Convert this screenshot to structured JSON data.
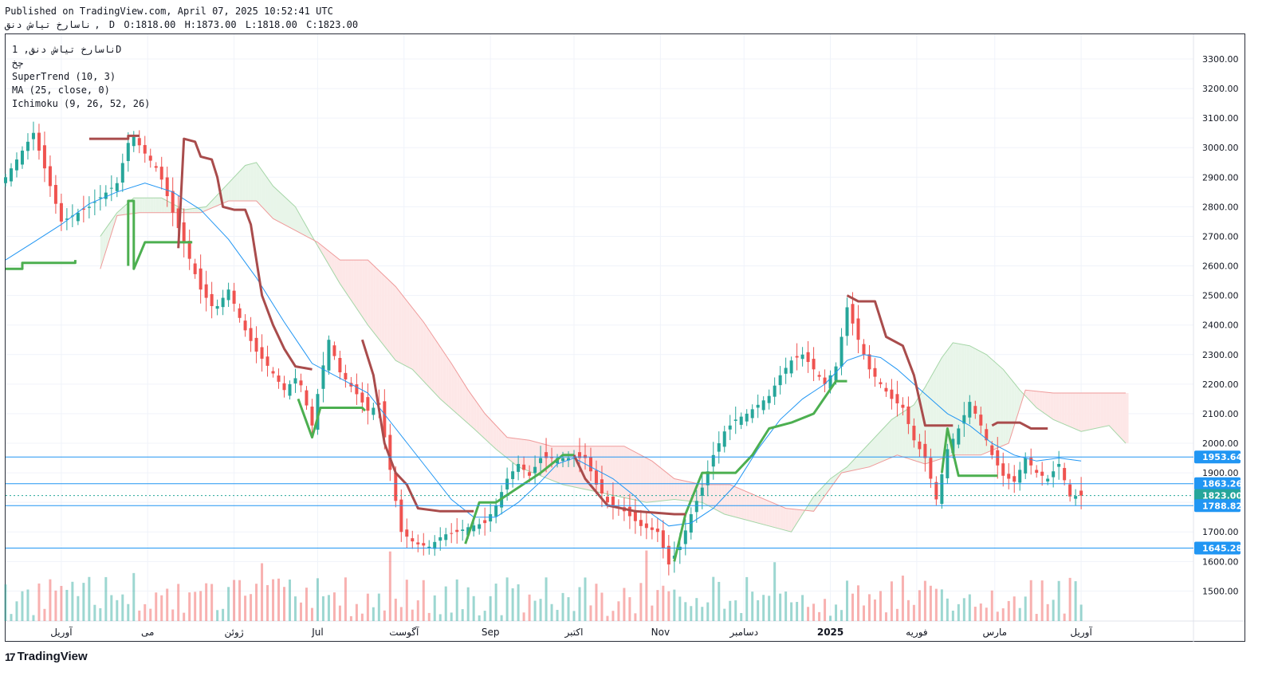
{
  "header": {
    "published": "Published on TradingView.com, April 07, 2025 10:52:41 UTC",
    "symbol": "ناسارخ  تیاش دنق",
    "interval": "D",
    "ohlc": {
      "o": "O:1818.00",
      "h": "H:1873.00",
      "l": "L:1818.00",
      "c": "C:1823.00"
    }
  },
  "legend": {
    "symbol_interval": "ناسارخ تیاش دنق, 1D",
    "alias": "چخ",
    "indicators": [
      "SuperTrend (10, 3)",
      "MA (25, close, 0)",
      "Ichimoku (9, 26, 52, 26)"
    ]
  },
  "footer": {
    "brand": "TradingView",
    "mark": "17"
  },
  "colors": {
    "up": "#26a69a",
    "down": "#ef5350",
    "supertrend_up": "#4caf50",
    "supertrend_down": "#a94c4c",
    "ma": "#2196f3",
    "cloud_up": "#e8f5e9",
    "cloud_down": "#fde7e7",
    "hline": "#2196f3",
    "label_blue": "#2196f3",
    "label_teal": "#26a69a"
  },
  "chart_data": {
    "type": "candlestick",
    "y_axis": {
      "min": 1400,
      "max": 3350,
      "ticks": [
        1500,
        1600,
        1700,
        1800,
        1900,
        2000,
        2100,
        2200,
        2300,
        2400,
        2500,
        2600,
        2700,
        2800,
        2900,
        3000,
        3100,
        3200,
        3300
      ],
      "tick_labels": [
        "1500.00",
        "1600.00",
        "1700.00",
        "1800.00",
        "1900.00",
        "2000.00",
        "2100.00",
        "2200.00",
        "2300.00",
        "2400.00",
        "2500.00",
        "2600.00",
        "2700.00",
        "2800.00",
        "2900.00",
        "3000.00",
        "3100.00",
        "3200.00",
        "3300.00"
      ]
    },
    "x_labels": [
      {
        "label": "آوریل",
        "day": 20
      },
      {
        "label": "می",
        "day": 51
      },
      {
        "label": "ژوئن",
        "day": 82
      },
      {
        "label": "Jul",
        "day": 112
      },
      {
        "label": "آگوست",
        "day": 143
      },
      {
        "label": "Sep",
        "day": 174
      },
      {
        "label": "اکتبر",
        "day": 204
      },
      {
        "label": "Nov",
        "day": 235
      },
      {
        "label": "دسامبر",
        "day": 265
      },
      {
        "label": "2025",
        "day": 296,
        "bold": true
      },
      {
        "label": "فوریه",
        "day": 327
      },
      {
        "label": "مارس",
        "day": 355
      },
      {
        "label": "آوریل",
        "day": 386
      }
    ],
    "x_range_days": [
      0,
      410
    ],
    "price_close_points": [
      [
        0,
        2900
      ],
      [
        10,
        3050
      ],
      [
        20,
        2750
      ],
      [
        30,
        2800
      ],
      [
        40,
        2880
      ],
      [
        45,
        3050
      ],
      [
        50,
        2980
      ],
      [
        55,
        2920
      ],
      [
        60,
        2780
      ],
      [
        65,
        2650
      ],
      [
        70,
        2520
      ],
      [
        75,
        2450
      ],
      [
        80,
        2520
      ],
      [
        85,
        2400
      ],
      [
        90,
        2310
      ],
      [
        95,
        2250
      ],
      [
        100,
        2180
      ],
      [
        105,
        2230
      ],
      [
        110,
        2060
      ],
      [
        113,
        2220
      ],
      [
        116,
        2350
      ],
      [
        120,
        2240
      ],
      [
        125,
        2180
      ],
      [
        130,
        2110
      ],
      [
        134,
        2130
      ],
      [
        138,
        1910
      ],
      [
        142,
        1700
      ],
      [
        147,
        1660
      ],
      [
        152,
        1650
      ],
      [
        157,
        1690
      ],
      [
        162,
        1700
      ],
      [
        167,
        1720
      ],
      [
        172,
        1730
      ],
      [
        176,
        1790
      ],
      [
        180,
        1880
      ],
      [
        184,
        1930
      ],
      [
        188,
        1890
      ],
      [
        192,
        1950
      ],
      [
        196,
        1950
      ],
      [
        200,
        1950
      ],
      [
        204,
        1950
      ],
      [
        208,
        1950
      ],
      [
        212,
        1860
      ],
      [
        216,
        1800
      ],
      [
        222,
        1770
      ],
      [
        228,
        1720
      ],
      [
        234,
        1700
      ],
      [
        238,
        1590
      ],
      [
        242,
        1650
      ],
      [
        246,
        1760
      ],
      [
        250,
        1850
      ],
      [
        254,
        1960
      ],
      [
        258,
        2040
      ],
      [
        262,
        2080
      ],
      [
        266,
        2100
      ],
      [
        270,
        2130
      ],
      [
        274,
        2160
      ],
      [
        278,
        2230
      ],
      [
        282,
        2280
      ],
      [
        286,
        2300
      ],
      [
        290,
        2250
      ],
      [
        294,
        2200
      ],
      [
        298,
        2260
      ],
      [
        302,
        2460
      ],
      [
        306,
        2350
      ],
      [
        310,
        2250
      ],
      [
        314,
        2200
      ],
      [
        318,
        2150
      ],
      [
        322,
        2120
      ],
      [
        326,
        2010
      ],
      [
        330,
        1950
      ],
      [
        334,
        1810
      ],
      [
        338,
        1980
      ],
      [
        342,
        2050
      ],
      [
        346,
        2140
      ],
      [
        350,
        2060
      ],
      [
        354,
        1960
      ],
      [
        358,
        1890
      ],
      [
        362,
        1870
      ],
      [
        366,
        1950
      ],
      [
        370,
        1900
      ],
      [
        374,
        1880
      ],
      [
        378,
        1930
      ],
      [
        382,
        1820
      ],
      [
        386,
        1823
      ]
    ],
    "ma_points": [
      [
        0,
        2620
      ],
      [
        10,
        2680
      ],
      [
        20,
        2740
      ],
      [
        30,
        2810
      ],
      [
        40,
        2850
      ],
      [
        50,
        2880
      ],
      [
        60,
        2850
      ],
      [
        70,
        2790
      ],
      [
        80,
        2690
      ],
      [
        90,
        2560
      ],
      [
        100,
        2410
      ],
      [
        110,
        2270
      ],
      [
        120,
        2220
      ],
      [
        130,
        2170
      ],
      [
        140,
        2050
      ],
      [
        150,
        1930
      ],
      [
        160,
        1810
      ],
      [
        168,
        1750
      ],
      [
        176,
        1750
      ],
      [
        184,
        1800
      ],
      [
        192,
        1870
      ],
      [
        198,
        1930
      ],
      [
        204,
        1950
      ],
      [
        210,
        1920
      ],
      [
        218,
        1880
      ],
      [
        226,
        1820
      ],
      [
        232,
        1760
      ],
      [
        238,
        1720
      ],
      [
        246,
        1730
      ],
      [
        254,
        1780
      ],
      [
        262,
        1860
      ],
      [
        270,
        1980
      ],
      [
        278,
        2080
      ],
      [
        286,
        2150
      ],
      [
        294,
        2200
      ],
      [
        302,
        2280
      ],
      [
        308,
        2300
      ],
      [
        314,
        2290
      ],
      [
        320,
        2250
      ],
      [
        326,
        2200
      ],
      [
        332,
        2150
      ],
      [
        338,
        2100
      ],
      [
        346,
        2060
      ],
      [
        354,
        2000
      ],
      [
        362,
        1960
      ],
      [
        370,
        1940
      ],
      [
        378,
        1950
      ],
      [
        386,
        1940
      ]
    ],
    "supertrend_up": [
      [
        [
          0,
          2590
        ],
        [
          6,
          2590
        ],
        [
          6,
          2610
        ],
        [
          25,
          2610
        ],
        [
          25,
          2620
        ]
      ],
      [
        [
          44,
          2600
        ],
        [
          44,
          2820
        ],
        [
          46,
          2820
        ],
        [
          46,
          2590
        ],
        [
          50,
          2680
        ],
        [
          67,
          2680
        ]
      ],
      [
        [
          105,
          2150
        ],
        [
          110,
          2020
        ],
        [
          113,
          2120
        ],
        [
          128,
          2120
        ],
        [
          129,
          2110
        ]
      ],
      [
        [
          165,
          1660
        ],
        [
          170,
          1800
        ],
        [
          176,
          1800
        ],
        [
          184,
          1850
        ],
        [
          192,
          1900
        ],
        [
          200,
          1960
        ],
        [
          204,
          1960
        ]
      ],
      [
        [
          240,
          1600
        ],
        [
          244,
          1760
        ],
        [
          250,
          1900
        ],
        [
          262,
          1900
        ],
        [
          268,
          1960
        ],
        [
          274,
          2050
        ],
        [
          282,
          2070
        ],
        [
          290,
          2100
        ],
        [
          298,
          2210
        ],
        [
          302,
          2210
        ]
      ],
      [
        [
          336,
          1900
        ],
        [
          338,
          2050
        ],
        [
          342,
          1890
        ],
        [
          352,
          1890
        ],
        [
          356,
          1890
        ]
      ]
    ],
    "supertrend_down": [
      [
        [
          30,
          3030
        ],
        [
          44,
          3030
        ],
        [
          44,
          3040
        ],
        [
          48,
          3040
        ]
      ],
      [
        [
          62,
          2660
        ],
        [
          64,
          3030
        ],
        [
          68,
          3020
        ],
        [
          70,
          2970
        ],
        [
          74,
          2960
        ],
        [
          76,
          2900
        ],
        [
          78,
          2800
        ],
        [
          82,
          2790
        ],
        [
          86,
          2790
        ],
        [
          88,
          2740
        ],
        [
          92,
          2500
        ],
        [
          96,
          2400
        ],
        [
          100,
          2320
        ],
        [
          104,
          2260
        ],
        [
          110,
          2250
        ]
      ],
      [
        [
          128,
          2350
        ],
        [
          132,
          2230
        ],
        [
          136,
          2000
        ],
        [
          140,
          1900
        ],
        [
          144,
          1860
        ],
        [
          148,
          1780
        ],
        [
          156,
          1770
        ],
        [
          168,
          1770
        ]
      ],
      [
        [
          204,
          1960
        ],
        [
          208,
          1880
        ],
        [
          216,
          1790
        ],
        [
          226,
          1770
        ],
        [
          240,
          1760
        ],
        [
          244,
          1760
        ]
      ],
      [
        [
          302,
          2500
        ],
        [
          306,
          2480
        ],
        [
          312,
          2480
        ],
        [
          316,
          2360
        ],
        [
          322,
          2330
        ],
        [
          326,
          2230
        ],
        [
          330,
          2060
        ],
        [
          336,
          2060
        ],
        [
          340,
          2060
        ]
      ],
      [
        [
          354,
          2060
        ],
        [
          356,
          2070
        ],
        [
          364,
          2070
        ],
        [
          368,
          2050
        ],
        [
          374,
          2050
        ]
      ]
    ],
    "cloud_boundaries": {
      "span_a": [
        [
          34,
          2700
        ],
        [
          40,
          2780
        ],
        [
          46,
          2830
        ],
        [
          56,
          2830
        ],
        [
          64,
          2790
        ],
        [
          72,
          2800
        ],
        [
          80,
          2880
        ],
        [
          86,
          2940
        ],
        [
          90,
          2950
        ],
        [
          96,
          2870
        ],
        [
          104,
          2800
        ],
        [
          110,
          2700
        ],
        [
          120,
          2540
        ],
        [
          130,
          2400
        ],
        [
          140,
          2280
        ],
        [
          146,
          2250
        ],
        [
          156,
          2150
        ],
        [
          162,
          2100
        ],
        [
          168,
          2050
        ],
        [
          176,
          1980
        ],
        [
          184,
          1920
        ],
        [
          192,
          1890
        ],
        [
          200,
          1860
        ],
        [
          210,
          1840
        ],
        [
          220,
          1820
        ],
        [
          230,
          1800
        ],
        [
          240,
          1810
        ],
        [
          250,
          1800
        ],
        [
          258,
          1760
        ],
        [
          266,
          1740
        ],
        [
          274,
          1720
        ],
        [
          282,
          1700
        ],
        [
          290,
          1820
        ],
        [
          296,
          1880
        ],
        [
          302,
          1920
        ],
        [
          310,
          2000
        ],
        [
          318,
          2080
        ],
        [
          326,
          2130
        ],
        [
          330,
          2190
        ],
        [
          336,
          2290
        ],
        [
          340,
          2340
        ],
        [
          346,
          2330
        ],
        [
          352,
          2300
        ],
        [
          358,
          2250
        ],
        [
          364,
          2180
        ],
        [
          370,
          2120
        ],
        [
          376,
          2080
        ],
        [
          386,
          2040
        ],
        [
          396,
          2060
        ],
        [
          402,
          2000
        ]
      ],
      "span_b": [
        [
          34,
          2590
        ],
        [
          40,
          2770
        ],
        [
          48,
          2780
        ],
        [
          60,
          2780
        ],
        [
          70,
          2780
        ],
        [
          80,
          2820
        ],
        [
          90,
          2820
        ],
        [
          96,
          2760
        ],
        [
          104,
          2720
        ],
        [
          112,
          2680
        ],
        [
          120,
          2620
        ],
        [
          130,
          2620
        ],
        [
          140,
          2530
        ],
        [
          150,
          2410
        ],
        [
          160,
          2270
        ],
        [
          166,
          2180
        ],
        [
          172,
          2100
        ],
        [
          180,
          2020
        ],
        [
          188,
          2010
        ],
        [
          196,
          1990
        ],
        [
          206,
          1990
        ],
        [
          214,
          1990
        ],
        [
          222,
          1990
        ],
        [
          232,
          1940
        ],
        [
          240,
          1880
        ],
        [
          250,
          1860
        ],
        [
          260,
          1860
        ],
        [
          270,
          1820
        ],
        [
          280,
          1780
        ],
        [
          290,
          1770
        ],
        [
          300,
          1900
        ],
        [
          310,
          1920
        ],
        [
          320,
          1960
        ],
        [
          330,
          1930
        ],
        [
          340,
          1960
        ],
        [
          350,
          1960
        ],
        [
          360,
          2000
        ],
        [
          366,
          2180
        ],
        [
          376,
          2170
        ],
        [
          390,
          2170
        ],
        [
          402,
          2170
        ]
      ]
    },
    "horizontal_levels": [
      1953.64,
      1863.26,
      1823.0,
      1788.82,
      1645.28
    ],
    "price_labels": [
      {
        "text": "1953.64",
        "value": 1953.64,
        "color": "#2196f3"
      },
      {
        "text": "1863.26",
        "value": 1863.26,
        "color": "#2196f3"
      },
      {
        "text": "1823.00",
        "value": 1823.0,
        "color": "#26a69a"
      },
      {
        "text": "1788.82",
        "value": 1788.82,
        "color": "#2196f3"
      },
      {
        "text": "1645.28",
        "value": 1645.28,
        "color": "#2196f3"
      }
    ],
    "last_price": 1823.0
  }
}
